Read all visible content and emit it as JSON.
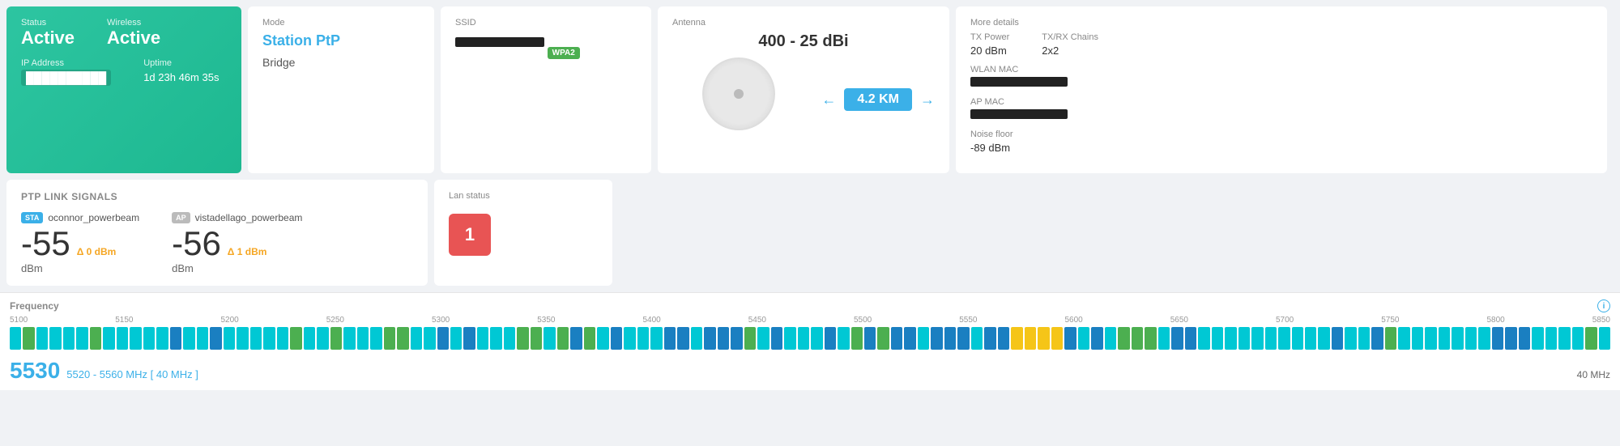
{
  "status": {
    "label_status": "Status",
    "label_wireless": "Wireless",
    "status_value": "Active",
    "wireless_value": "Active",
    "label_ip": "IP Address",
    "label_uptime": "Uptime",
    "uptime_value": "1d 23h 46m 35s"
  },
  "mode": {
    "label": "Mode",
    "title": "Station PtP",
    "sub": "Bridge"
  },
  "ssid": {
    "label": "SSID",
    "badge": "WPA2"
  },
  "antenna": {
    "label": "Antenna",
    "model": "400 - 25 dBi",
    "distance": "4.2 KM"
  },
  "more": {
    "label": "More details",
    "tx_power_label": "TX Power",
    "tx_power_value": "20 dBm",
    "tx_rx_chains_label": "TX/RX Chains",
    "tx_rx_chains_value": "2x2",
    "wlan_mac_label": "WLAN MAC",
    "ap_mac_label": "AP MAC",
    "noise_floor_label": "Noise floor",
    "noise_floor_value": "-89 dBm"
  },
  "ptp": {
    "title": "PTP Link Signals",
    "devices": [
      {
        "role": "STA",
        "name": "oconnor_powerbeam",
        "signal": "-55",
        "delta": "Δ 0 dBm",
        "unit": "dBm"
      },
      {
        "role": "AP",
        "name": "vistadellago_powerbeam",
        "signal": "-56",
        "delta": "Δ 1 dBm",
        "unit": "dBm"
      }
    ]
  },
  "lan": {
    "title": "Lan status",
    "port_number": "1"
  },
  "frequency": {
    "title": "Frequency",
    "main": "5530",
    "range": "5520 - 5560 MHz [ 40 MHz ]",
    "bandwidth": "40 MHz",
    "scale": [
      "5100",
      "5150",
      "5200",
      "5250",
      "5300",
      "5350",
      "5400",
      "5450",
      "5500",
      "5550",
      "5600",
      "5650",
      "5700",
      "5750",
      "5800",
      "5850"
    ],
    "bars": [
      "cyan",
      "cyan",
      "blue",
      "blue",
      "cyan",
      "green",
      "blue",
      "cyan",
      "cyan",
      "cyan",
      "cyan",
      "cyan",
      "cyan",
      "cyan",
      "cyan",
      "cyan",
      "cyan",
      "blue",
      "blue",
      "green",
      "cyan",
      "cyan",
      "blue",
      "cyan",
      "cyan",
      "cyan",
      "cyan",
      "cyan",
      "cyan",
      "cyan",
      "cyan",
      "blue",
      "blue",
      "green",
      "cyan",
      "cyan",
      "cyan",
      "cyan",
      "cyan",
      "cyan",
      "cyan",
      "cyan",
      "cyan",
      "cyan",
      "cyan",
      "cyan",
      "blue",
      "green",
      "green",
      "cyan",
      "cyan",
      "cyan",
      "cyan",
      "cyan",
      "cyan",
      "cyan",
      "cyan",
      "cyan",
      "yellow",
      "cyan",
      "cyan",
      "blue",
      "green",
      "cyan",
      "cyan",
      "cyan",
      "cyan",
      "cyan",
      "cyan",
      "cyan",
      "cyan",
      "cyan",
      "cyan",
      "blue",
      "cyan",
      "cyan",
      "green",
      "cyan",
      "cyan",
      "cyan",
      "cyan",
      "cyan",
      "cyan",
      "cyan",
      "cyan",
      "cyan",
      "cyan",
      "blue",
      "blue",
      "cyan"
    ]
  }
}
